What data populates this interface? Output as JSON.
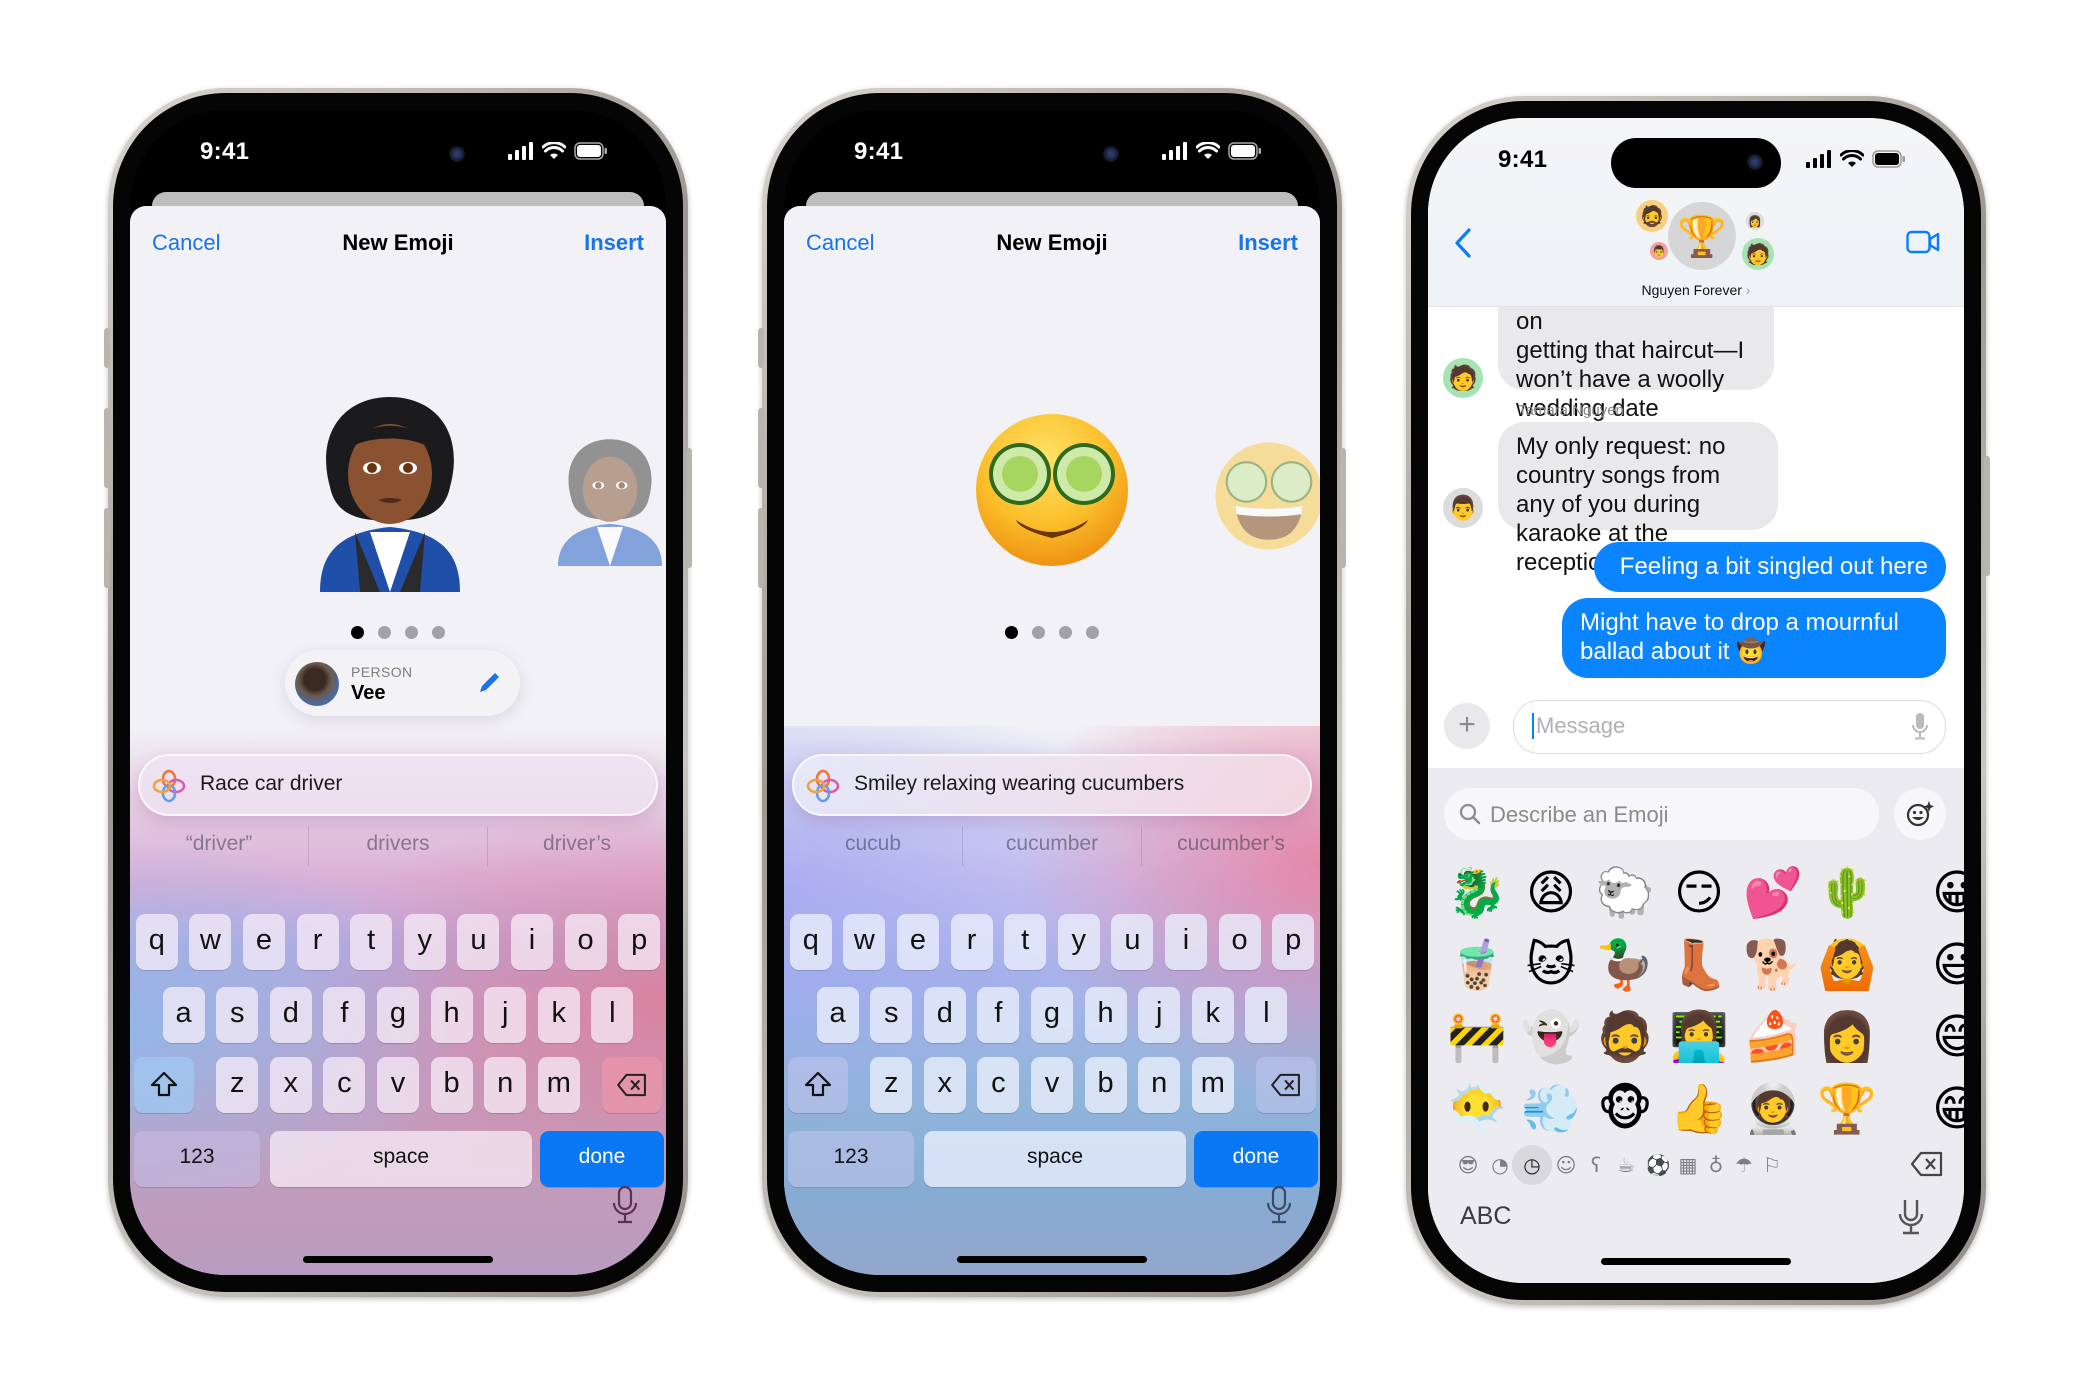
{
  "colors": {
    "accent": "#1a73e8",
    "imessage_blue": "#0a84ff",
    "done_key": "#0a77f5",
    "received_bubble": "#e9e9eb",
    "sheet_bg": "#f2f2f6"
  },
  "phones": [
    {
      "status": {
        "time": "9:41"
      },
      "header": {
        "cancel": "Cancel",
        "title": "New Emoji",
        "insert": "Insert"
      },
      "preview": {
        "current": "woman race car driver (Vee)",
        "next": "alternate race car driver variant",
        "page_count": 4,
        "current_page": 1
      },
      "person_chip": {
        "label": "PERSON",
        "name": "Vee",
        "edit_icon": "pencil-icon"
      },
      "prompt": {
        "icon": "apple-intelligence-icon",
        "value": "Race car driver"
      },
      "suggestions": [
        "“driver”",
        "drivers",
        "driver’s"
      ],
      "keyboard": {
        "row1": [
          "q",
          "w",
          "e",
          "r",
          "t",
          "y",
          "u",
          "i",
          "o",
          "p"
        ],
        "row2": [
          "a",
          "s",
          "d",
          "f",
          "g",
          "h",
          "j",
          "k",
          "l"
        ],
        "row3": [
          "z",
          "x",
          "c",
          "v",
          "b",
          "n",
          "m"
        ],
        "numbers": "123",
        "space": "space",
        "done": "done"
      }
    },
    {
      "status": {
        "time": "9:41"
      },
      "header": {
        "cancel": "Cancel",
        "title": "New Emoji",
        "insert": "Insert"
      },
      "preview": {
        "current": "smiley with cucumber slices on eyes",
        "next": "grinning smiley with cucumber slices",
        "page_count": 4,
        "current_page": 1
      },
      "prompt": {
        "icon": "apple-intelligence-icon",
        "value": "Smiley relaxing wearing cucumbers"
      },
      "suggestions": [
        "cucub",
        "cucumber",
        "cucumber’s"
      ],
      "keyboard": {
        "row1": [
          "q",
          "w",
          "e",
          "r",
          "t",
          "y",
          "u",
          "i",
          "o",
          "p"
        ],
        "row2": [
          "a",
          "s",
          "d",
          "f",
          "g",
          "h",
          "j",
          "k",
          "l"
        ],
        "row3": [
          "z",
          "x",
          "c",
          "v",
          "b",
          "n",
          "m"
        ],
        "numbers": "123",
        "space": "space",
        "done": "done"
      }
    }
  ],
  "messages_phone": {
    "status": {
      "time": "9:41"
    },
    "conversation": {
      "group_name": "Nguyen Forever",
      "group_icon": "🏆"
    },
    "messages": [
      {
        "direction": "in",
        "text_clipped": "Yu, please just focus on",
        "text": "getting that haircut—I won’t have a woolly wedding date"
      },
      {
        "direction": "in",
        "sender": "Tamara Nguyen",
        "text": "My only request: no country songs from any of you during karaoke at the reception"
      },
      {
        "direction": "out",
        "text": "Feeling a bit singled out here"
      },
      {
        "direction": "out",
        "text": "Might have to drop a mournful ballad about it 🤠"
      }
    ],
    "input": {
      "placeholder": "Message"
    },
    "emoji_keyboard": {
      "search_placeholder": "Describe an Emoji",
      "grid": [
        [
          "🐉",
          "😩",
          "🐑",
          "😏",
          "💕",
          "🌵",
          "😀"
        ],
        [
          "🧋",
          "🐱",
          "🦆",
          "👢",
          "🐕",
          "🙆",
          "😃"
        ],
        [
          "🚧",
          "👻",
          "🧔",
          "👩‍💻",
          "🍰",
          "👩",
          "😄"
        ],
        [
          "😶‍🌫️",
          "💨",
          "🐵",
          "👍",
          "🧑‍🚀",
          "🏆",
          "😁"
        ]
      ],
      "categories": [
        "memoji",
        "stickers",
        "recent",
        "smileys",
        "animals",
        "food",
        "activity",
        "travel",
        "objects",
        "symbols",
        "flags"
      ],
      "selected_category": "recent",
      "abc_label": "ABC"
    }
  }
}
